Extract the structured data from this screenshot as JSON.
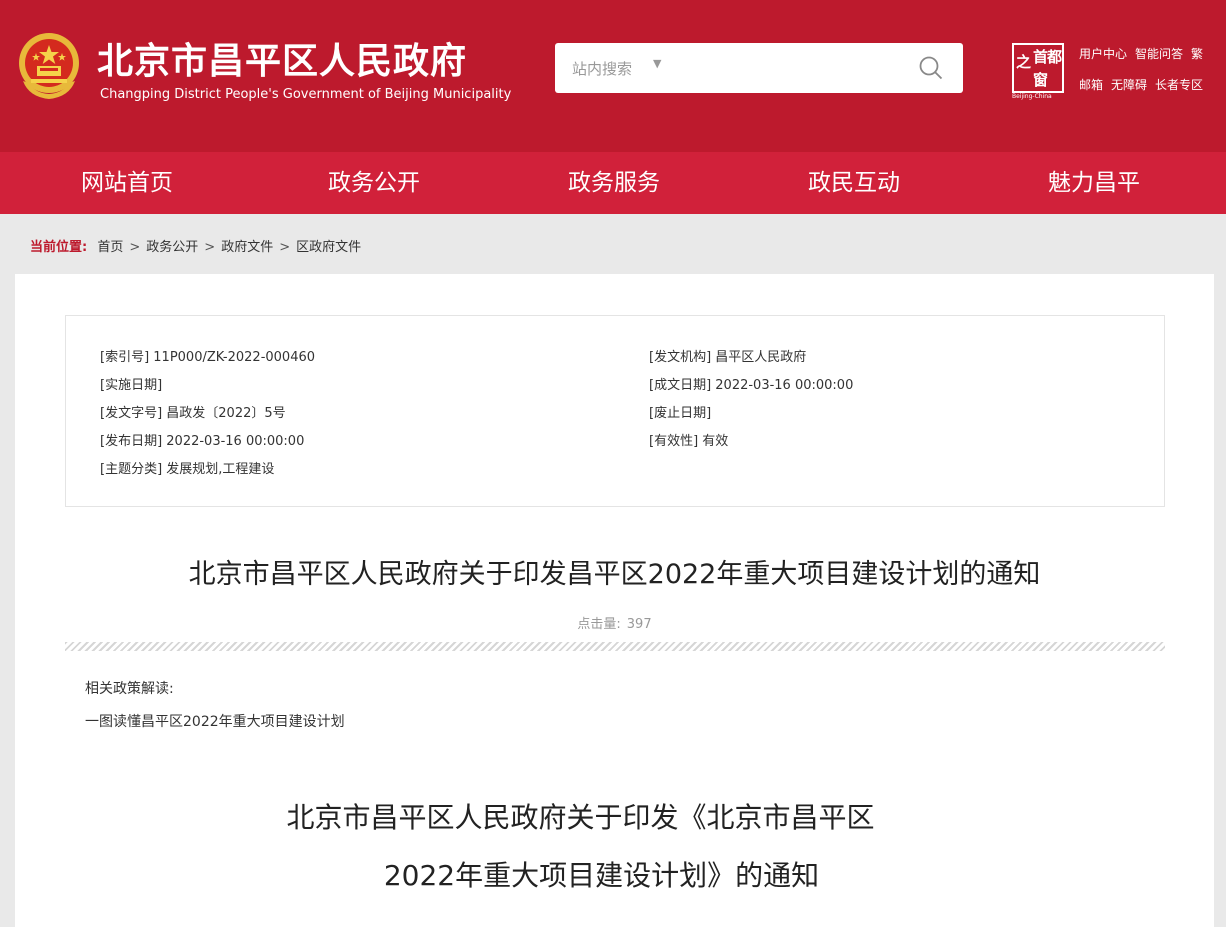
{
  "header": {
    "title": "北京市昌平区人民政府",
    "subtitle": "Changping District People's Government of Beijing Municipality",
    "search_placeholder": "站内搜索",
    "window_logo": {
      "chars": [
        "首",
        "都",
        "之",
        "窗"
      ],
      "caption": "Beijing-China"
    },
    "links_row1": [
      "用户中心",
      "智能问答",
      "繁"
    ],
    "links_row2": [
      "邮箱",
      "无障碍",
      "长者专区"
    ],
    "colors": {
      "primary": "#bd1a2d",
      "nav": "#d1213a"
    }
  },
  "nav": [
    "网站首页",
    "政务公开",
    "政务服务",
    "政民互动",
    "魅力昌平"
  ],
  "breadcrumb": {
    "label": "当前位置:",
    "items": [
      "首页",
      "政务公开",
      "政府文件",
      "区政府文件"
    ]
  },
  "meta": {
    "index_no": "[索引号] 11P000/ZK-2022-000460",
    "issuer": "[发文机构] 昌平区人民政府",
    "effective_date": "[实施日期]",
    "written_date": "[成文日期] 2022-03-16 00:00:00",
    "doc_no": "[发文字号] 昌政发〔2022〕5号",
    "expire_date": "[废止日期]",
    "publish_date": "[发布日期] 2022-03-16 00:00:00",
    "validity": "[有效性] 有效",
    "category": "[主题分类] 发展规划,工程建设"
  },
  "doc": {
    "title": "北京市昌平区人民政府关于印发昌平区2022年重大项目建设计划的通知",
    "hits_label": "点击量:",
    "hits_value": "397",
    "related_label": "相关政策解读:",
    "related_link": "一图读懂昌平区2022年重大项目建设计划",
    "body_title_line1": "北京市昌平区人民政府关于印发《北京市昌平区",
    "body_title_line2": "2022年重大项目建设计划》的通知"
  }
}
